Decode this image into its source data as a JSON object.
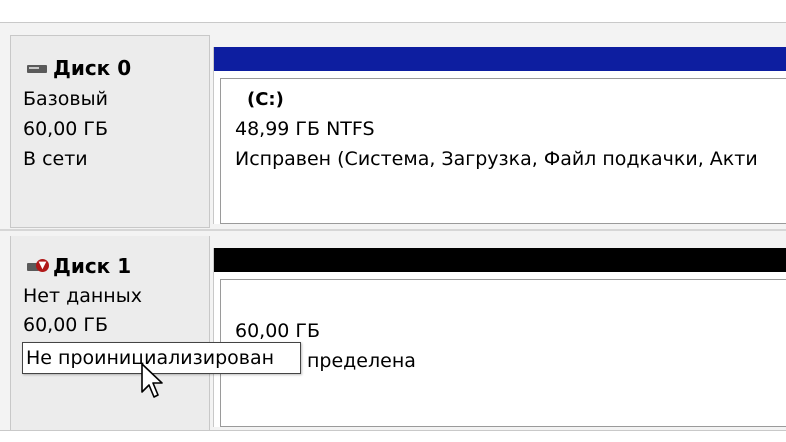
{
  "disks": [
    {
      "title": "Диск 0",
      "type": "Базовый",
      "size": "60,00 ГБ",
      "status": "В сети",
      "icon": "hard-disk-icon",
      "header_color": "#0d1ea0",
      "partition": {
        "name": "(C:)",
        "size_fs": "48,99 ГБ NTFS",
        "status": "Исправен (Система, Загрузка, Файл подкачки, Акти"
      }
    },
    {
      "title": "Диск 1",
      "type": "Нет данных",
      "size": "60,00 ГБ",
      "status": "Не проинициализирован",
      "icon": "hard-disk-error-icon",
      "header_color": "#000000",
      "partition": {
        "size": "60,00 ГБ",
        "status_visible": "пределена"
      }
    }
  ],
  "tooltip": {
    "text": "Не проинициализирован"
  }
}
